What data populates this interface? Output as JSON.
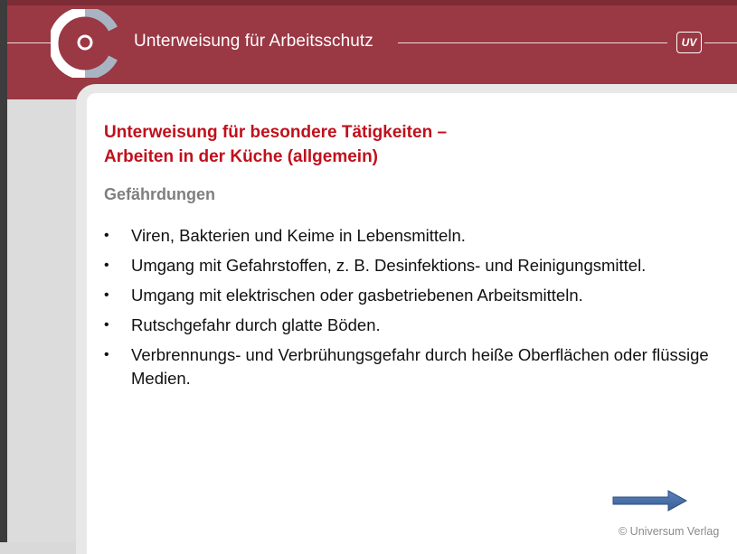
{
  "header": {
    "title": "Unterweisung für Arbeitsschutz",
    "badge": "UV",
    "brand_color": "#9a3844",
    "logo_icon": "ring-logo-icon"
  },
  "slide": {
    "title_line1": "Unterweisung für besondere Tätigkeiten –",
    "title_line2": "Arbeiten in der Küche (allgemein)",
    "title_color": "#c0101c",
    "section_heading": "Gefährdungen",
    "bullet_symbol": "•",
    "bullets": [
      "Viren, Bakterien und Keime in Lebensmitteln.",
      "Umgang mit Gefahrstoffen, z. B. Desinfektions- und Reinigungsmittel.",
      "Umgang mit elektrischen oder gasbetriebenen Arbeitsmitteln.",
      "Rutschgefahr durch glatte Böden.",
      "Verbrennungs- und Verbrühungsgefahr durch heiße Oberflächen oder flüssige Medien."
    ]
  },
  "footer": {
    "next_icon": "arrow-right-icon",
    "copyright": "© Universum Verlag"
  }
}
